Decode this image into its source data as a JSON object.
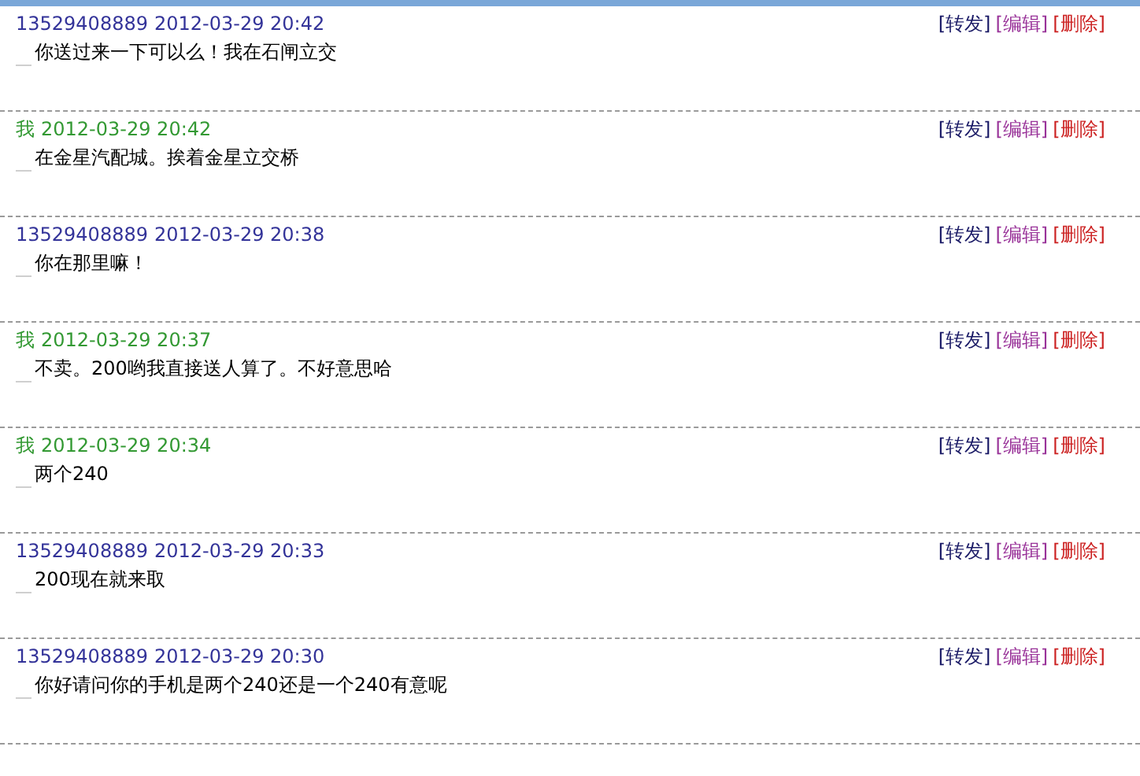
{
  "messages": [
    {
      "sender": "13529408889",
      "kind": "incoming",
      "time": "2012-03-29 20:42",
      "text": "你送过来一下可以么！我在石闸立交",
      "actions": [
        {
          "label": "[转发]",
          "color": "#1a1a66"
        },
        {
          "label": "[编辑]",
          "color": "#993399"
        },
        {
          "label": "[删除]",
          "color": "#cc2222"
        }
      ]
    },
    {
      "sender": "我",
      "kind": "outgoing",
      "time": "2012-03-29 20:42",
      "text": "在金星汽配城。挨着金星立交桥",
      "actions": [
        {
          "label": "[转发]",
          "color": "#1a1a66"
        },
        {
          "label": "[编辑]",
          "color": "#993399"
        },
        {
          "label": "[删除]",
          "color": "#cc2222"
        }
      ]
    },
    {
      "sender": "13529408889",
      "kind": "incoming",
      "time": "2012-03-29 20:38",
      "text": "你在那里嘛！",
      "actions": [
        {
          "label": "[转发]",
          "color": "#1a1a66"
        },
        {
          "label": "[编辑]",
          "color": "#993399"
        },
        {
          "label": "[删除]",
          "color": "#cc2222"
        }
      ]
    },
    {
      "sender": "我",
      "kind": "outgoing",
      "time": "2012-03-29 20:37",
      "text": "不卖。200哟我直接送人算了。不好意思哈",
      "actions": [
        {
          "label": "[转发]",
          "color": "#1a1a66"
        },
        {
          "label": "[编辑]",
          "color": "#993399"
        },
        {
          "label": "[删除]",
          "color": "#cc2222"
        }
      ]
    },
    {
      "sender": "我",
      "kind": "outgoing",
      "time": "2012-03-29 20:34",
      "text": "两个240",
      "actions": [
        {
          "label": "[转发]",
          "color": "#1a1a66"
        },
        {
          "label": "[编辑]",
          "color": "#993399"
        },
        {
          "label": "[删除]",
          "color": "#cc2222"
        }
      ]
    },
    {
      "sender": "13529408889",
      "kind": "incoming",
      "time": "2012-03-29 20:33",
      "text": "200现在就来取",
      "actions": [
        {
          "label": "[转发]",
          "color": "#1a1a66"
        },
        {
          "label": "[编辑]",
          "color": "#993399"
        },
        {
          "label": "[删除]",
          "color": "#cc2222"
        }
      ]
    },
    {
      "sender": "13529408889",
      "kind": "incoming",
      "time": "2012-03-29 20:30",
      "text": "你好请问你的手机是两个240还是一个240有意呢",
      "actions": [
        {
          "label": "[转发]",
          "color": "#1a1a66"
        },
        {
          "label": "[编辑]",
          "color": "#993399"
        },
        {
          "label": "[删除]",
          "color": "#cc2222"
        }
      ]
    }
  ]
}
